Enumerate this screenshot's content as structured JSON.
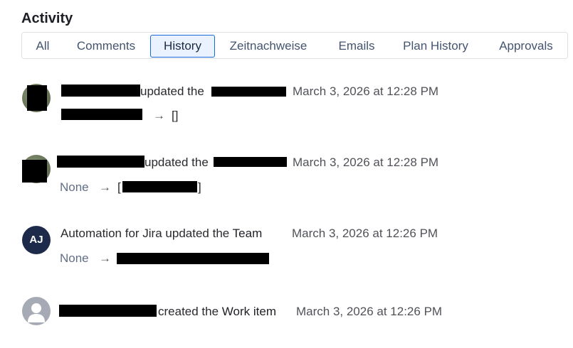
{
  "activity": {
    "title": "Activity",
    "tabs": [
      {
        "label": "All",
        "selected": false
      },
      {
        "label": "Comments",
        "selected": false
      },
      {
        "label": "History",
        "selected": true
      },
      {
        "label": "Zeitnachweise",
        "selected": false
      },
      {
        "label": "Emails",
        "selected": false
      },
      {
        "label": "Plan History",
        "selected": false
      },
      {
        "label": "Approvals",
        "selected": false
      }
    ]
  },
  "entries": [
    {
      "action": "updated the",
      "timestamp": "March 3, 2026 at 12:28 PM",
      "change_arrow": "→",
      "change_to": "[]"
    },
    {
      "action": "updated the",
      "timestamp": "March 3, 2026 at 12:28 PM",
      "change_from": "None",
      "change_arrow": "→",
      "bracket_open": "[",
      "bracket_close": "]"
    },
    {
      "avatar_initials": "AJ",
      "actor": "Automation for Jira",
      "action": "updated the",
      "field": "Team",
      "timestamp": "March 3, 2026 at 12:26 PM",
      "change_from": "None",
      "change_arrow": "→"
    },
    {
      "action": "created the",
      "field": "Work item",
      "timestamp": "March 3, 2026 at 12:26 PM"
    }
  ]
}
